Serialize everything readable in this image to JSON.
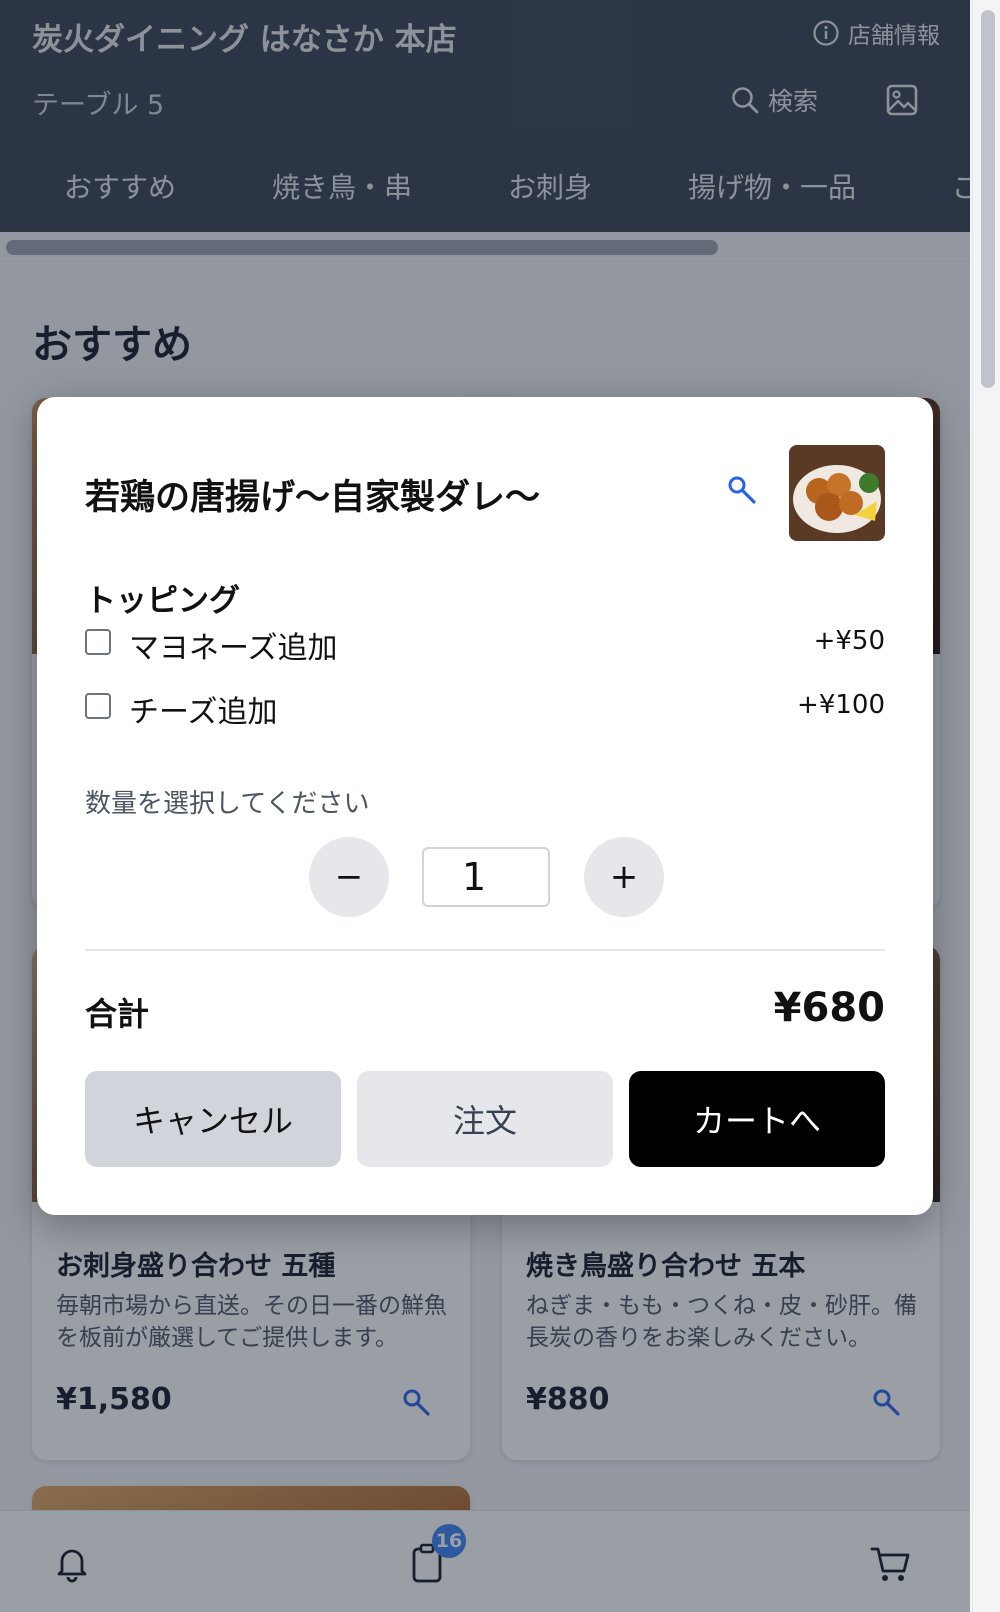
{
  "header": {
    "store_name": "炭火ダイニング はなさか 本店",
    "store_info_label": "店舗情報",
    "table_label": "テーブル 5",
    "search_label": "検索"
  },
  "categories": [
    "おすすめ",
    "焼き鳥・串",
    "お刺身",
    "揚げ物・一品",
    "ご"
  ],
  "section_title": "おすすめ",
  "cards": [
    {
      "title": "お刺身盛り合わせ 五種",
      "desc": "毎朝市場から直送。その日一番の鮮魚を板前が厳選してご提供します。",
      "price": "¥1,580"
    },
    {
      "title": "焼き鳥盛り合わせ 五本",
      "desc": "ねぎま・もも・つくね・皮・砂肝。備長炭の香りをお楽しみください。",
      "price": "¥880"
    }
  ],
  "bottom_nav": {
    "order_count_badge": "16"
  },
  "modal": {
    "title": "若鶏の唐揚げ〜自家製ダレ〜",
    "topping_heading": "トッピング",
    "options": [
      {
        "label": "マヨネーズ追加",
        "price": "+¥50",
        "checked": false
      },
      {
        "label": "チーズ追加",
        "price": "+¥100",
        "checked": false
      }
    ],
    "quantity_label": "数量を選択してください",
    "quantity_value": "1",
    "minus_label": "−",
    "plus_label": "+",
    "total_label": "合計",
    "total_value": "¥680",
    "cancel_label": "キャンセル",
    "order_label": "注文",
    "cart_label": "カートへ"
  },
  "colors": {
    "header_bg": "#374151",
    "accent_blue": "#3b82f6",
    "cart_button_bg": "#000000"
  }
}
